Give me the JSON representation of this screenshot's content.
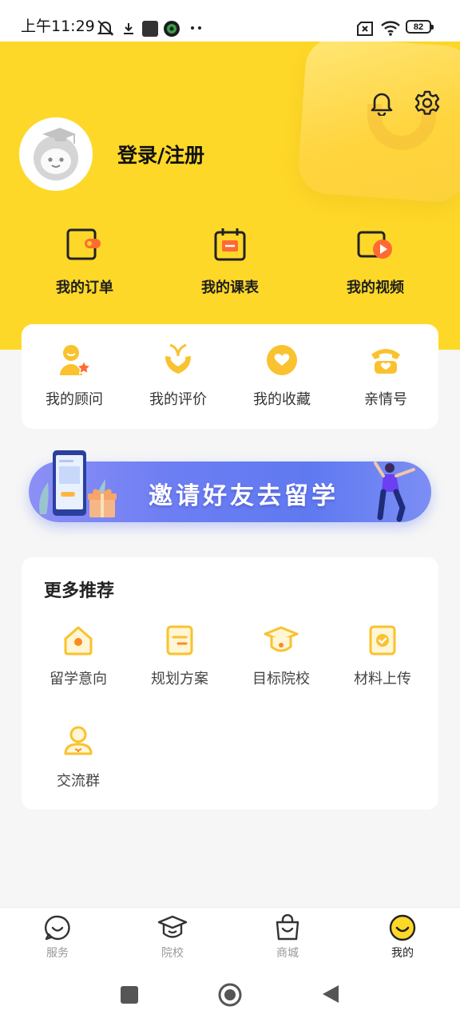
{
  "status_bar": {
    "time": "上午11:29",
    "battery": "82"
  },
  "header": {
    "login_label": "登录/注册",
    "quick_links": [
      {
        "label": "我的订单",
        "icon": "order-icon"
      },
      {
        "label": "我的课表",
        "icon": "calendar-icon"
      },
      {
        "label": "我的视频",
        "icon": "video-icon"
      }
    ]
  },
  "services": [
    {
      "label": "我的顾问",
      "icon": "advisor-icon"
    },
    {
      "label": "我的评价",
      "icon": "review-icon"
    },
    {
      "label": "我的收藏",
      "icon": "favorite-icon"
    },
    {
      "label": "亲情号",
      "icon": "phone-icon"
    }
  ],
  "banner": {
    "text": "邀请好友去留学"
  },
  "more": {
    "title": "更多推荐",
    "items": [
      {
        "label": "留学意向",
        "icon": "intent-icon"
      },
      {
        "label": "规划方案",
        "icon": "plan-icon"
      },
      {
        "label": "目标院校",
        "icon": "school-icon"
      },
      {
        "label": "材料上传",
        "icon": "upload-icon"
      },
      {
        "label": "交流群",
        "icon": "group-icon"
      }
    ]
  },
  "bottom_nav": {
    "tabs": [
      {
        "label": "服务",
        "icon": "service-tab-icon",
        "active": false
      },
      {
        "label": "院校",
        "icon": "school-tab-icon",
        "active": false
      },
      {
        "label": "商城",
        "icon": "mall-tab-icon",
        "active": false
      },
      {
        "label": "我的",
        "icon": "me-tab-icon",
        "active": true
      }
    ]
  },
  "colors": {
    "brand_yellow": "#fed829",
    "icon_yellow": "#f9c22e",
    "banner_blue": "#6d7ef3",
    "icon_orange": "#ff6a33"
  }
}
